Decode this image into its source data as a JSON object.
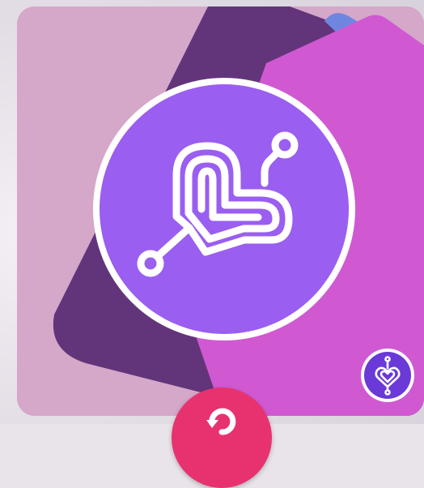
{
  "card": {
    "icon": "connected-hearts-logo-icon",
    "colors": {
      "background": "#d5a7c9",
      "shape_dark": "#62357a",
      "shape_blue": "#6f86e0",
      "shape_magenta": "#d059d2",
      "logo_circle": "#9a5ef0",
      "logo_stroke": "#ffffff"
    }
  },
  "badge": {
    "icon": "heart-connection-badge-icon",
    "colors": {
      "ring": "#ffffff",
      "fill": "#6a39d7"
    }
  },
  "fab": {
    "icon": "refresh-icon",
    "color": "#e8326f"
  }
}
